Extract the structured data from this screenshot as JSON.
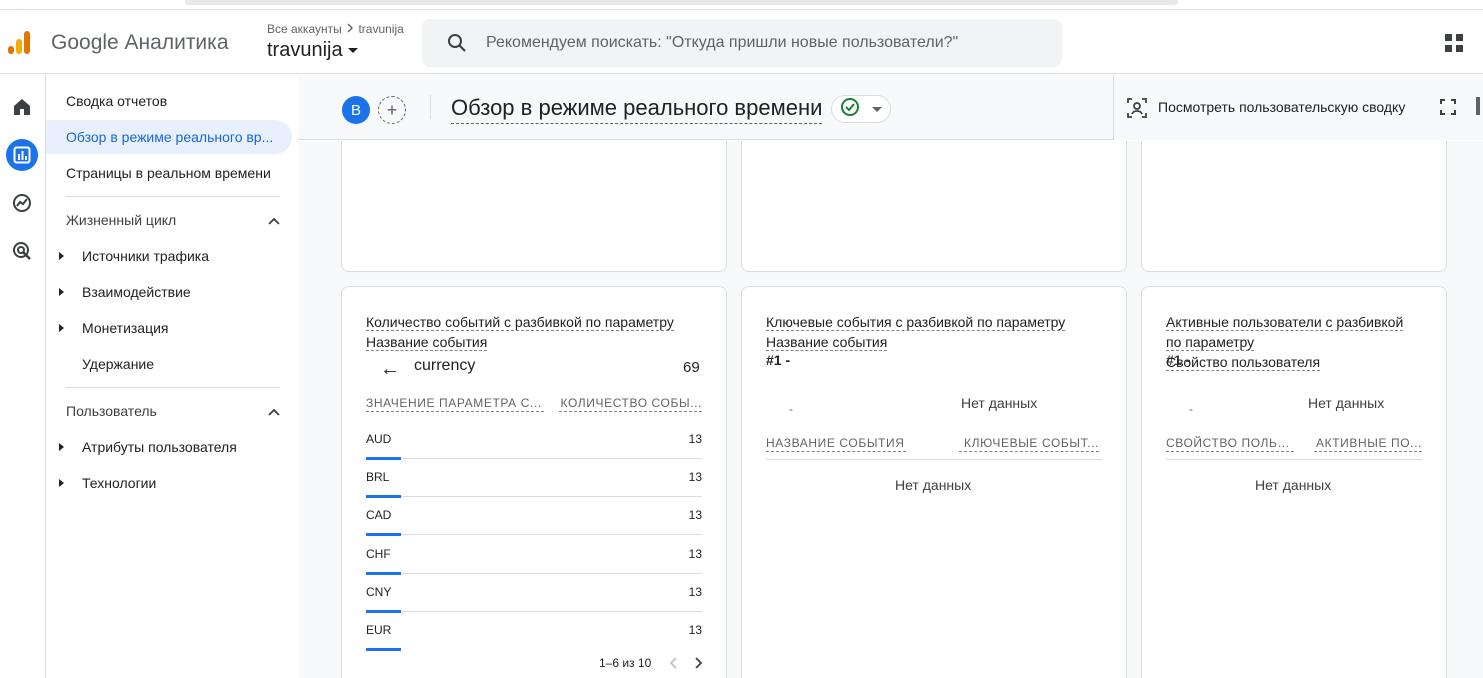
{
  "app": {
    "brand": "Google Аналитика",
    "account_path": "Все аккаунты",
    "account_path_property": "travunija",
    "property_name": "travunija"
  },
  "search": {
    "placeholder": "Рекомендуем поискать: \"Откуда пришли новые пользователи?\""
  },
  "nav": {
    "items": [
      {
        "label": "Сводка отчетов"
      },
      {
        "label": "Обзор в режиме реального вр..."
      },
      {
        "label": "Страницы в реальном времени"
      }
    ],
    "lifecycle": {
      "title": "Жизненный цикл",
      "items": [
        "Источники трафика",
        "Взаимодействие",
        "Монетизация",
        "Удержание"
      ]
    },
    "user": {
      "title": "Пользователь",
      "items": [
        "Атрибуты пользователя",
        "Технологии"
      ]
    }
  },
  "header": {
    "avatar_letter": "B",
    "add_symbol": "+",
    "title": "Обзор в режиме реального времени",
    "custom_summary": "Посмотреть пользовательскую сводку"
  },
  "cards": {
    "events": {
      "title_line1": "Количество событий с разбивкой по параметру",
      "title_line2": "Название события",
      "back": "←",
      "dimension": "currency",
      "total": "69",
      "col1": "ЗНАЧЕНИЕ ПАРАМЕТРА С...",
      "col2": "КОЛИЧЕСТВО СОБЫ...",
      "rows": [
        {
          "k": "AUD",
          "v": "13"
        },
        {
          "k": "BRL",
          "v": "13"
        },
        {
          "k": "CAD",
          "v": "13"
        },
        {
          "k": "CHF",
          "v": "13"
        },
        {
          "k": "CNY",
          "v": "13"
        },
        {
          "k": "EUR",
          "v": "13"
        }
      ],
      "pager": "1–6 из 10"
    },
    "key_events": {
      "title_line1": "Ключевые события с разбивкой по параметру",
      "title_line2": "Название события",
      "rank": "#1  -",
      "dash": "-",
      "no_data": "Нет данных",
      "col1": "НАЗВАНИЕ СОБЫТИЯ",
      "col2": "КЛЮЧЕВЫЕ СОБЫТ...",
      "table_no_data": "Нет данных"
    },
    "active_users": {
      "title_line1": "Активные пользователи с разбивкой",
      "title_line2": "по параметру",
      "title_line3": "Свойство пользователя",
      "rank": "#1  -",
      "dash": "-",
      "no_data": "Нет данных",
      "col1": "СВОЙСТВО ПОЛЬЗ...",
      "col2": "АКТИВНЫЕ ПО...",
      "table_no_data": "Нет данных"
    }
  },
  "colors": {
    "accent": "#1a73e8",
    "nav_active_bg": "#e8f0fe",
    "check": "#188038"
  }
}
